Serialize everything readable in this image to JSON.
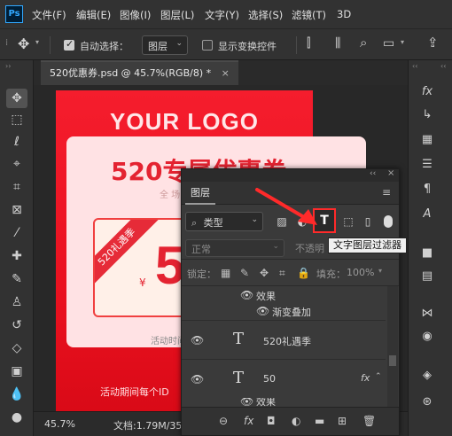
{
  "menubar": {
    "logo": "Ps",
    "items": [
      "文件(F)",
      "编辑(E)",
      "图像(I)",
      "图层(L)",
      "文字(Y)",
      "选择(S)",
      "滤镜(T)",
      "3D"
    ]
  },
  "options": {
    "auto_select_label": "自动选择：",
    "layer_select_value": "图层",
    "show_transform_label": "显示变换控件"
  },
  "document": {
    "tab_title": "520优惠券.psd @ 45.7%(RGB/8) *",
    "tab_close": "×"
  },
  "poster": {
    "logo": "YOUR LOGO",
    "title": "520专属优惠券",
    "subtitle": "全 场",
    "ribbon": "520礼遇季",
    "currency": "¥",
    "amount": "5",
    "activity_time": "活动时间",
    "footer": "活动期间每个ID"
  },
  "statusbar": {
    "zoom": "45.7%",
    "doc_info": "文档:1.79M/35"
  },
  "layers_panel": {
    "tab_label": "图层",
    "collapse": "‹‹",
    "close": "×",
    "menu": "≡",
    "filter_type": "类型",
    "blend_mode": "正常",
    "opacity_label": "不透明",
    "lock_label": "锁定：",
    "fill_label": "填充：",
    "fill_value": "100%",
    "layers": [
      {
        "kind": "effect-header",
        "label": "效果"
      },
      {
        "kind": "effect",
        "label": "渐变叠加"
      },
      {
        "kind": "text",
        "label": "520礼遇季"
      },
      {
        "kind": "text",
        "label": "50",
        "fx": "fx"
      },
      {
        "kind": "effect-header",
        "label": "效果"
      }
    ],
    "text_glyph": "T"
  },
  "tooltip": "文字图层过滤器",
  "colors": {
    "highlight_red": "#ff2a2a",
    "poster_red": "#f51d2d",
    "ps_blue": "#31a8ff"
  }
}
